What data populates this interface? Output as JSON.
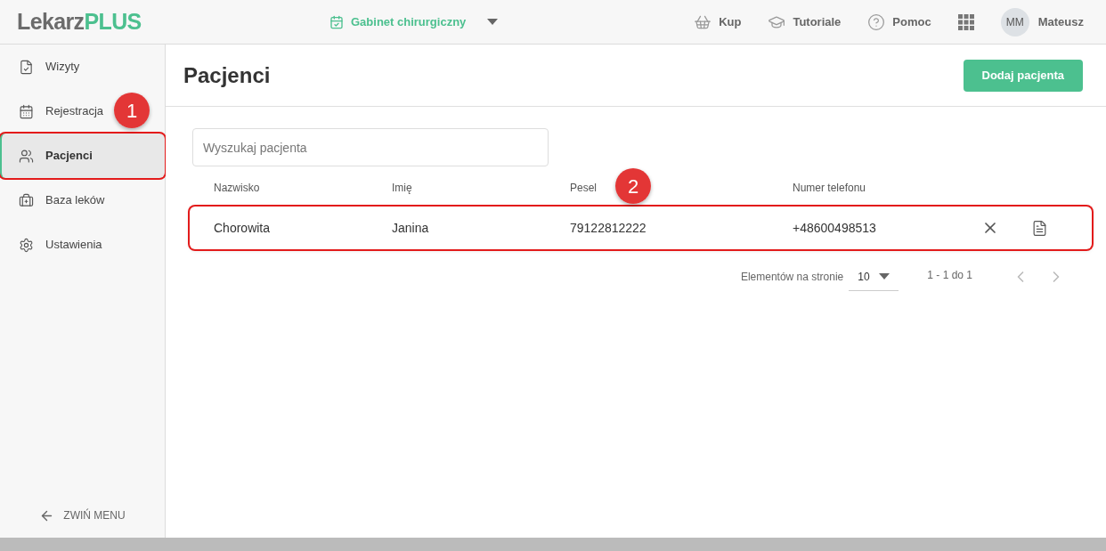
{
  "header": {
    "logo": {
      "part_1": "Lekarz",
      "part_2": "PLUS"
    },
    "clinic": "Gabinet chirurgiczny",
    "links": [
      {
        "label": "Kup"
      },
      {
        "label": "Tutoriale"
      },
      {
        "label": "Pomoc"
      }
    ],
    "user": {
      "initials": "MM",
      "name": "Mateusz"
    }
  },
  "sidebar": {
    "items": [
      {
        "label": "Wizyty",
        "selected": false,
        "highlighted": false
      },
      {
        "label": "Rejestracja",
        "selected": false,
        "highlighted": false
      },
      {
        "label": "Pacjenci",
        "selected": true,
        "highlighted": true
      },
      {
        "label": "Baza leków",
        "selected": false,
        "highlighted": false
      },
      {
        "label": "Ustawienia",
        "selected": false,
        "highlighted": false
      }
    ],
    "collapse": "ZWIŃ MENU"
  },
  "page": {
    "title": "Pacjenci",
    "add_button": "Dodaj pacjenta",
    "search": {
      "placeholder": "Wyszukaj pacjenta"
    },
    "table": {
      "columns": [
        "Nazwisko",
        "Imię",
        "Pesel",
        "Numer telefonu"
      ],
      "rows": [
        {
          "cells": [
            "Chorowita",
            "Janina",
            "79122812222",
            "+48600498513"
          ],
          "highlighted": true
        }
      ]
    },
    "pagination": {
      "label": "Elementów na stronie",
      "page_size": "10",
      "range": "1 - 1 do 1"
    }
  },
  "annotations": [
    {
      "label": "1"
    },
    {
      "label": "2"
    }
  ]
}
